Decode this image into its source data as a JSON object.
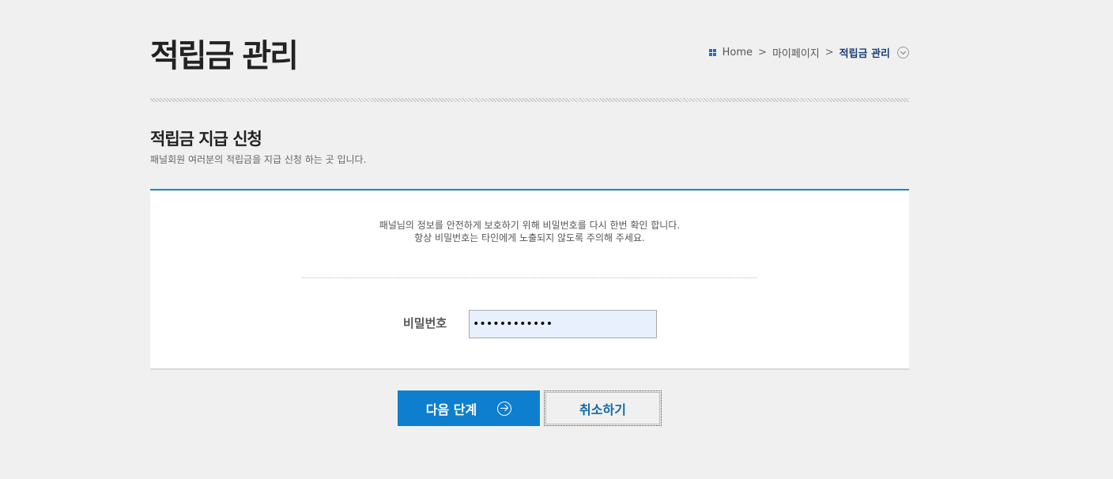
{
  "header": {
    "title": "적립금 관리"
  },
  "breadcrumb": {
    "items": [
      "Home",
      "마이페이지"
    ],
    "separator": ">",
    "current": "적립금 관리"
  },
  "section": {
    "title": "적립금 지급 신청",
    "description": "패널회원 여러분의 적립금을 지급 신청 하는 곳 입니다."
  },
  "notice": {
    "line1": "패널님의 정보를 안전하게 보호하기 위해 비밀번호를 다시 한번 확인 합니다.",
    "line2": "항상 비밀번호는 타인에게 노출되지 않도록 주의해 주세요."
  },
  "form": {
    "password_label": "비밀번호",
    "password_value": "••••••••••••"
  },
  "buttons": {
    "next_label": "다음 단계",
    "cancel_label": "취소하기"
  },
  "colors": {
    "accent": "#0e7fce",
    "breadcrumb_current": "#1a3f78"
  }
}
